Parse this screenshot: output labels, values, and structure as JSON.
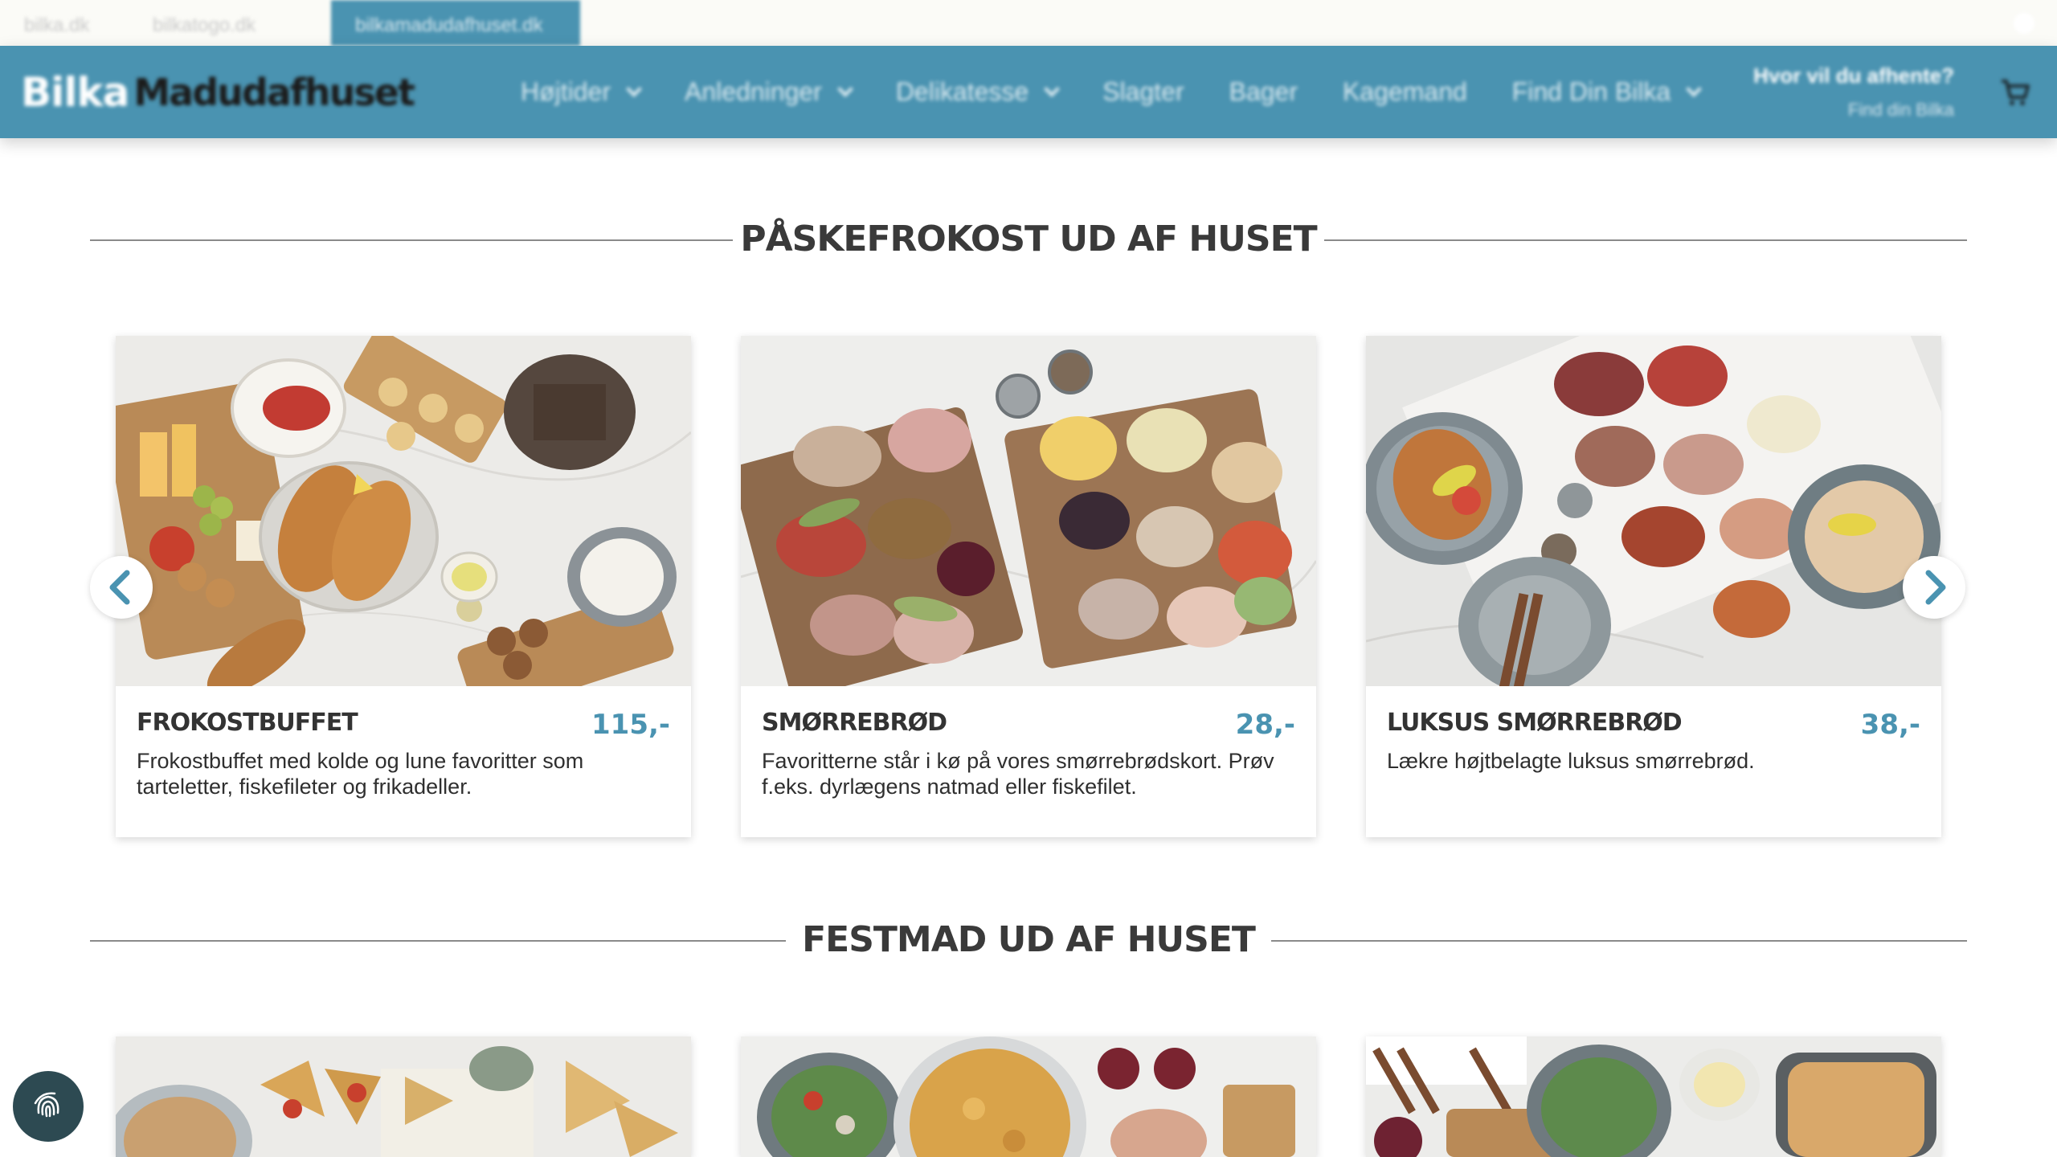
{
  "site_tabs": [
    "bilka.dk",
    "bilkatogo.dk",
    "bilkamadudafhuset.dk"
  ],
  "header": {
    "logo_mark": "Bilka",
    "logo_text": "Madudafhuset",
    "nav": [
      {
        "label": "Højtider",
        "dropdown": true
      },
      {
        "label": "Anledninger",
        "dropdown": true
      },
      {
        "label": "Delikatesse",
        "dropdown": true
      },
      {
        "label": "Slagter",
        "dropdown": false
      },
      {
        "label": "Bager",
        "dropdown": false
      },
      {
        "label": "Kagemand",
        "dropdown": false
      },
      {
        "label": "Find Din Bilka",
        "dropdown": true
      }
    ],
    "store_question": "Hvor vil du afhente?",
    "store_link": "Find din Bilka"
  },
  "sections": [
    {
      "title": "PÅSKEFROKOST UD AF HUSET",
      "cards": [
        {
          "title": "FROKOSTBUFFET",
          "price": "115,-",
          "desc": "Frokostbuffet med kolde og lune favoritter som tarteletter, fiskefileter og frikadeller."
        },
        {
          "title": "SMØRREBRØD",
          "price": "28,-",
          "desc": "Favoritterne står i kø på vores smørrebrødskort. Prøv f.eks. dyrlægens natmad eller fiskefilet."
        },
        {
          "title": "LUKSUS SMØRREBRØD",
          "price": "38,-",
          "desc": "Lækre højtbelagte luksus smørrebrød."
        }
      ]
    },
    {
      "title": "FESTMAD UD AF HUSET"
    }
  ],
  "colors": {
    "brand": "#4a93b1",
    "price": "#4a93b1",
    "heading": "#3a3a3a",
    "fingerprint_button": "#2d4a52"
  },
  "icons": {
    "carousel_prev": "chevron-left-icon",
    "carousel_next": "chevron-right-icon",
    "nav_dropdown": "chevron-down-icon",
    "cart": "cart-icon",
    "fingerprint": "fingerprint-icon"
  }
}
